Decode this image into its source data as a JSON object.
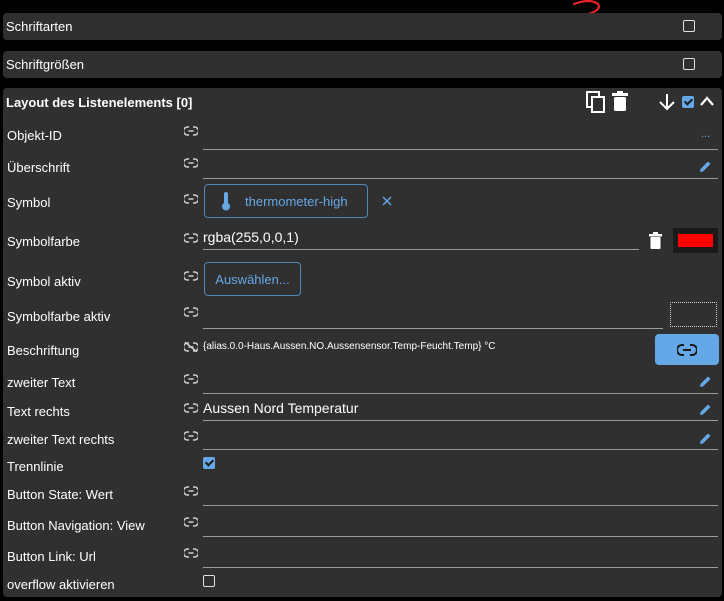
{
  "annotation": {
    "mark": "3",
    "color": "#e8202a"
  },
  "sections": {
    "fonts": {
      "title": "Schriftarten"
    },
    "font_sizes": {
      "title": "Schriftgrößen"
    },
    "layout": {
      "title": "Layout des Listenelements [0]"
    }
  },
  "rows": {
    "object_id": {
      "label": "Objekt-ID",
      "value": "",
      "more": "..."
    },
    "heading": {
      "label": "Überschrift",
      "value": ""
    },
    "symbol": {
      "label": "Symbol",
      "icon": "thermometer-high"
    },
    "symbol_color": {
      "label": "Symbolfarbe",
      "value": "rgba(255,0,0,1)",
      "swatch": "#ff0000"
    },
    "symbol_active": {
      "label": "Symbol aktiv",
      "button": "Auswählen..."
    },
    "symbol_color_active": {
      "label": "Symbolfarbe aktiv",
      "value": ""
    },
    "caption": {
      "label": "Beschriftung",
      "value": "{alias.0.0-Haus.Aussen.NO.Aussensensor.Temp-Feucht.Temp} °C"
    },
    "second_text": {
      "label": "zweiter Text",
      "value": ""
    },
    "text_right": {
      "label": "Text rechts",
      "value": "Aussen Nord Temperatur"
    },
    "second_text_right": {
      "label": "zweiter Text rechts",
      "value": ""
    },
    "divider": {
      "label": "Trennlinie",
      "checked": true
    },
    "btn_state": {
      "label": "Button State: Wert",
      "value": ""
    },
    "btn_nav": {
      "label": "Button Navigation: View",
      "value": ""
    },
    "btn_link": {
      "label": "Button Link: Url",
      "value": ""
    },
    "overflow": {
      "label": "overflow aktivieren",
      "checked": false
    }
  },
  "colors": {
    "accent": "#64a8e8",
    "panel": "#303030",
    "background": "#000000"
  }
}
